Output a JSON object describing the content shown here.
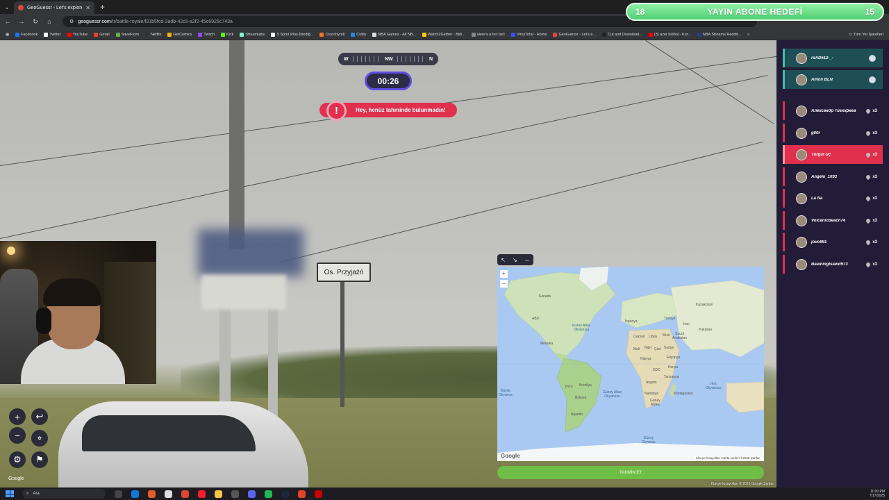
{
  "browser": {
    "tab_title": "GeoGuessr - Let's explore the ...",
    "url_host": "geoguessr.com",
    "url_path": "/tr/battle-royale/f31b5fcd-2adb-42c5-a2f2-45c6925c743a",
    "bookmarks": [
      "Facebook",
      "Twitter",
      "YouTube",
      "Gmail",
      "SaveFrom",
      "Netflix",
      "GetComics",
      "Twitch",
      "Kick",
      "Streamlabs",
      "S Sport Plus-İstediğ...",
      "Crunchyroll",
      "Cuttly",
      "NBA Games - All NB...",
      "Watch2Gether - Birli...",
      "Here's a fun fact",
      "VirusTotal - Home",
      "GeoGuessr - Let's e...",
      "Cut and Download...",
      "(3) azer bülbül - Kur...",
      "NBA Streams Reddit..."
    ],
    "bookmarks_more": "»",
    "bookmarks_all": "Tüm Yer İşaretleri"
  },
  "goal_overlay": {
    "current": "18",
    "title": "YAYIN ABONE HEDEFİ",
    "target": "15"
  },
  "hud": {
    "compass_left": "W",
    "compass_center": "NW",
    "compass_right": "N",
    "timer": "00:26",
    "warning_icon": "!",
    "warning_text": "Hey, henüz tahminde bulunmadın!"
  },
  "scene": {
    "road_sign": "Os. Przyjaźń",
    "google_logo": "Google",
    "credits": "Klavye kısayolları  © 2025 Google  Şartlar"
  },
  "sv_controls": {
    "zoom_in": "+",
    "zoom_out": "−",
    "undo": "↩",
    "pin": "⌖",
    "settings": "⚙",
    "flag": "⚑"
  },
  "map": {
    "labels": {
      "north_atlantic": "Kuzey Atlas\nOkyanusu",
      "south_atlantic": "Güney Atlas\nOkyanusu",
      "indian": "Hint\nOkyanusu",
      "southern": "Güney\nOkyanus",
      "pacific": "Büyük\nOkyanus",
      "usa": "ABD",
      "canada": "Kanada",
      "mexico": "Meksika",
      "brazil": "Brezilya",
      "peru": "Peru",
      "bolivia": "Bolivya",
      "argentina": "Arjantin",
      "spain": "İspanya",
      "algeria": "Cezayir",
      "libya": "Libya",
      "egypt": "Mısır",
      "mali": "Mali",
      "niger": "Nijer",
      "chad": "Çad",
      "sudan": "Sudan",
      "nigeria": "Nijerya",
      "ethiopia": "Etiyopya",
      "drc": "KDC",
      "kenya": "Kenya",
      "tanzania": "Tanzanya",
      "angola": "Angola",
      "namibia": "Namibya",
      "south_africa": "Güney\nAfrika",
      "madagascar": "Madagaskar",
      "turkey": "Türkiye",
      "iran": "İran",
      "saudi": "Suudi\nArabistan",
      "kazakhstan": "Kazakistan",
      "pakistan": "Pakistan"
    },
    "google_logo": "Google",
    "credits": "Klavye kısayolları  Harita verileri ©2025  Şartlar",
    "guess_button": "TAHMİN ET"
  },
  "players": [
    {
      "name": "rsAD512-_-",
      "type": "ally"
    },
    {
      "name": "Amon BLN",
      "type": "ally"
    },
    {
      "name": "Александр Тимофеев",
      "lives": "x3",
      "type": "enemy"
    },
    {
      "name": "g00r",
      "lives": "x3",
      "type": "enemy"
    },
    {
      "name": "Turgut Uç",
      "lives": "x3",
      "type": "self"
    },
    {
      "name": "Angelo_1093",
      "lives": "x3",
      "type": "enemy"
    },
    {
      "name": "La Na",
      "lives": "x3",
      "type": "enemy"
    },
    {
      "name": "VolcanicBeach74",
      "lives": "x3",
      "type": "enemy"
    },
    {
      "name": "jovo991",
      "lives": "x3",
      "type": "enemy"
    },
    {
      "name": "BeamingIsland973",
      "lives": "x3",
      "type": "enemy"
    }
  ],
  "taskbar": {
    "search_placeholder": "Ara",
    "time": "11:00 PM",
    "date": "7/17/2025"
  }
}
